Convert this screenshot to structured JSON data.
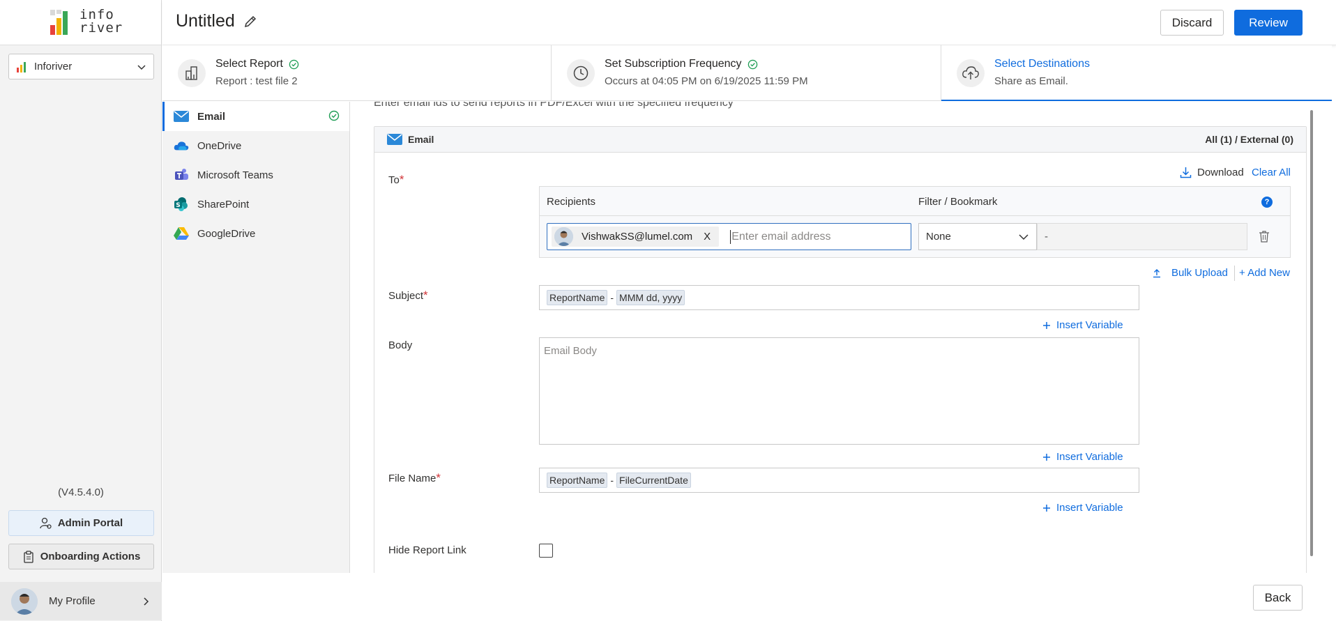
{
  "app": {
    "logo_text_line1": "info",
    "logo_text_line2": "river",
    "workspace": "Inforiver",
    "version": "(V4.5.4.0)",
    "admin_portal": "Admin Portal",
    "onboarding_actions": "Onboarding Actions",
    "my_profile": "My Profile"
  },
  "header": {
    "title": "Untitled",
    "discard": "Discard",
    "review": "Review"
  },
  "steps": [
    {
      "title": "Select Report",
      "subtitle": "Report : test file 2",
      "icon": "report-chart-icon",
      "done": true
    },
    {
      "title": "Set Subscription Frequency",
      "subtitle": "Occurs at 04:05 PM on 6/19/2025 11:59 PM",
      "icon": "clock-icon",
      "done": true
    },
    {
      "title": "Select Destinations",
      "subtitle": "Share as Email.",
      "icon": "cloud-upload-icon",
      "done": false,
      "active": true
    }
  ],
  "destinations": [
    {
      "label": "Email",
      "icon": "email-icon",
      "active": true,
      "done": true
    },
    {
      "label": "OneDrive",
      "icon": "onedrive-icon"
    },
    {
      "label": "Microsoft Teams",
      "icon": "teams-icon"
    },
    {
      "label": "SharePoint",
      "icon": "sharepoint-icon"
    },
    {
      "label": "GoogleDrive",
      "icon": "google-drive-icon"
    }
  ],
  "main": {
    "hint": "Enter email ids to send reports in PDF/Excel with the specified frequency",
    "card_title": "Email",
    "counts": "All (1) / External (0)",
    "to_label": "To",
    "download": "Download",
    "clear_all": "Clear All",
    "recipients_header": "Recipients",
    "filter_header": "Filter / Bookmark",
    "recipient_email": "VishwakSS@lumel.com",
    "chip_remove": "X",
    "email_placeholder": "Enter email address",
    "filter_value": "None",
    "filter_detail": "-",
    "bulk_upload": "Bulk Upload",
    "add_new": "+ Add New",
    "subject_label": "Subject",
    "subject_tokens": [
      "ReportName",
      "MMM dd, yyyy"
    ],
    "token_sep": "-",
    "insert_variable": "Insert Variable",
    "body_label": "Body",
    "body_placeholder": "Email Body",
    "file_name_label": "File Name",
    "file_tokens": [
      "ReportName",
      "FileCurrentDate"
    ],
    "hide_report_link": "Hide Report Link",
    "required_mark": "*"
  },
  "footer": {
    "back": "Back"
  },
  "colors": {
    "accent": "#0f6cde",
    "success": "#1f9d55",
    "required": "#d13438"
  }
}
